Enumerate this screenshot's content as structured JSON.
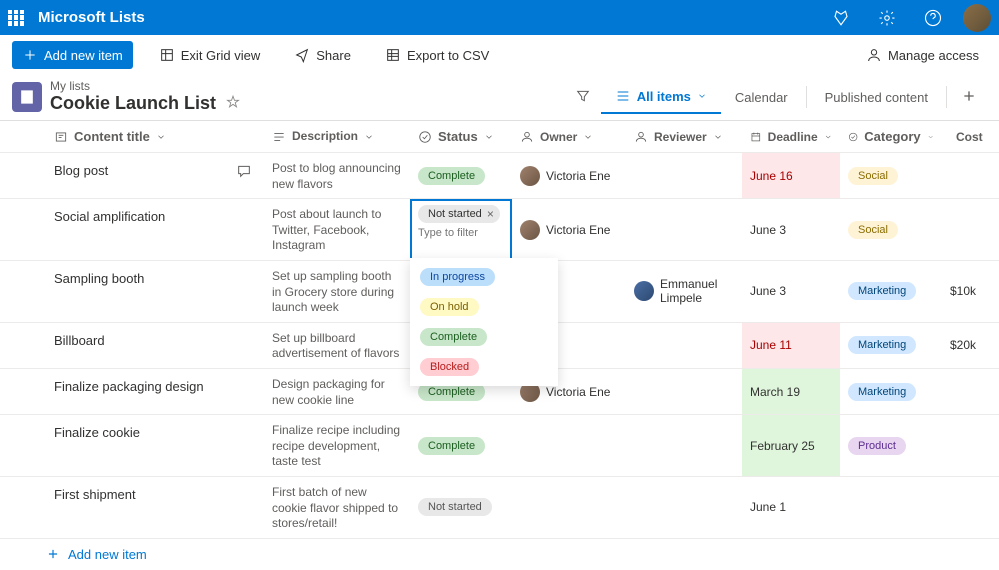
{
  "header": {
    "app_title": "Microsoft Lists"
  },
  "toolbar": {
    "add_label": "Add new item",
    "exit_label": "Exit Grid view",
    "share_label": "Share",
    "export_label": "Export to CSV",
    "manage_label": "Manage access"
  },
  "list": {
    "breadcrumb": "My lists",
    "title": "Cookie Launch List"
  },
  "views": {
    "all_items": "All items",
    "calendar": "Calendar",
    "published": "Published content"
  },
  "columns": {
    "title": "Content title",
    "description": "Description",
    "status": "Status",
    "owner": "Owner",
    "reviewer": "Reviewer",
    "deadline": "Deadline",
    "category": "Category",
    "cost": "Cost"
  },
  "status_editor": {
    "selected": "Not started",
    "placeholder": "Type to filter",
    "options": [
      {
        "label": "In progress",
        "cls": "pill-inprogress"
      },
      {
        "label": "On hold",
        "cls": "pill-onhold"
      },
      {
        "label": "Complete",
        "cls": "pill-complete"
      },
      {
        "label": "Blocked",
        "cls": "pill-blocked"
      }
    ]
  },
  "rows": [
    {
      "title": "Blog post",
      "has_comment": true,
      "description": "Post to blog announcing new flavors",
      "status": "Complete",
      "status_cls": "pill-complete",
      "owner": "Victoria Ene",
      "reviewer": "",
      "deadline": "June 16",
      "deadline_cls": "dl-red-cell",
      "category": "Social",
      "cat_cls": "cat-social",
      "cost": ""
    },
    {
      "title": "Social amplification",
      "description": "Post about launch to Twitter, Facebook, Instagram",
      "editing": true,
      "owner": "Victoria Ene",
      "reviewer": "",
      "deadline": "June 3",
      "deadline_cls": "",
      "category": "Social",
      "cat_cls": "cat-social",
      "cost": ""
    },
    {
      "title": "Sampling booth",
      "description": "Set up sampling booth in Grocery store during launch week",
      "status": "In progress",
      "status_cls": "pill-inprogress",
      "owner": "",
      "reviewer": "Emmanuel Limpele",
      "rev_avatar": "m2",
      "deadline": "June 3",
      "deadline_cls": "",
      "category": "Marketing",
      "cat_cls": "cat-marketing",
      "cost": "$10k"
    },
    {
      "title": "Billboard",
      "description": "Set up billboard advertisement of flavors",
      "status": "Complete",
      "status_cls": "pill-complete",
      "owner": "",
      "reviewer": "",
      "deadline": "June 11",
      "deadline_cls": "dl-red-cell",
      "category": "Marketing",
      "cat_cls": "cat-marketing",
      "cost": "$20k"
    },
    {
      "title": "Finalize packaging design",
      "description": "Design packaging for new cookie line",
      "status": "Complete",
      "status_cls": "pill-complete",
      "owner": "Victoria Ene",
      "reviewer": "",
      "deadline": "March 19",
      "deadline_cls": "dl-green-cell",
      "category": "Marketing",
      "cat_cls": "cat-marketing",
      "cost": ""
    },
    {
      "title": "Finalize cookie",
      "description": "Finalize recipe including recipe development, taste test",
      "status": "Complete",
      "status_cls": "pill-complete",
      "owner": "",
      "reviewer": "",
      "deadline": "February 25",
      "deadline_cls": "dl-green-cell",
      "category": "Product",
      "cat_cls": "cat-product",
      "cost": ""
    },
    {
      "title": "First shipment",
      "description": "First batch of new cookie flavor shipped to stores/retail!",
      "status": "Not started",
      "status_cls": "pill-notstarted",
      "owner": "",
      "reviewer": "",
      "deadline": "June 1",
      "deadline_cls": "",
      "category": "",
      "cat_cls": "",
      "cost": ""
    }
  ],
  "add_row": "Add new item"
}
